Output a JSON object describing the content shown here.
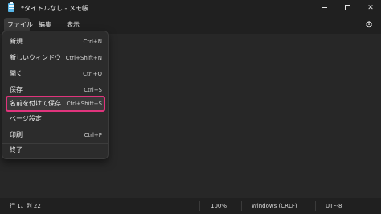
{
  "window": {
    "title": "*タイトルなし - メモ帳",
    "icon": "notepad-icon",
    "buttons": [
      "minimize-icon",
      "maximize-icon",
      "close-icon"
    ]
  },
  "menubar": {
    "file": "ファイル",
    "edit": "編集",
    "view": "表示",
    "settings_icon": "gear-icon"
  },
  "file_menu": {
    "items": [
      {
        "label": "新規",
        "shortcut": "Ctrl+N"
      },
      {
        "label": "新しいウィンドウ",
        "shortcut": "Ctrl+Shift+N"
      },
      {
        "label": "開く",
        "shortcut": "Ctrl+O"
      },
      {
        "label": "保存",
        "shortcut": "Ctrl+S"
      },
      {
        "label": "名前を付けて保存",
        "shortcut": "Ctrl+Shift+S"
      },
      {
        "label": "ページ設定",
        "shortcut": ""
      },
      {
        "label": "印刷",
        "shortcut": "Ctrl+P"
      },
      {
        "label": "終了",
        "shortcut": ""
      }
    ],
    "highlighted_color": "#e0347c"
  },
  "statusbar": {
    "position": "行 1、列 22",
    "zoom": "100%",
    "line_ending": "Windows (CRLF)",
    "encoding": "UTF-8"
  }
}
